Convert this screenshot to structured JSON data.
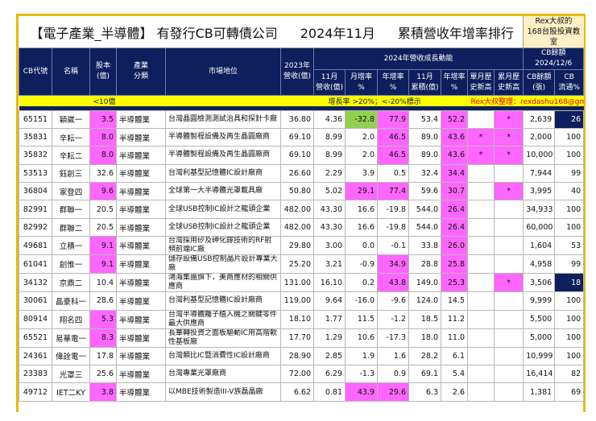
{
  "title": {
    "part1": "【電子產業_半導體】 有發行CB可轉債公司",
    "part2": "2024年11月",
    "part3": "累積營收年增率排行",
    "brand": "Rex大叔的\n168台股投資教室"
  },
  "headers": {
    "code": "CB代號",
    "name": "名稱",
    "capital": "股本\n(億)",
    "industry": "產業\n分類",
    "position": "市場地位",
    "rev2023": "2023年\n營收(億)",
    "growth_group": "2024年營收成長動能",
    "nov_rev": "11月\n營收(億)",
    "mom": "月增率\n%",
    "yoy": "年增率\n%",
    "cum": "11月\n累積(億)",
    "cum_yoy": "年增率\n%",
    "single_high": "單月歷\n史新高",
    "cum_high": "累月歷\n史新高",
    "cb_group": "CB餘額\n2024/12/6",
    "cb_balance": "CB餘額\n(張)",
    "cb_float": "CB\n流通%"
  },
  "legend": {
    "capital_note": "<10億",
    "growth_note": "增長率 >20%；<-20%標示",
    "credit": "Rex大叔整理：rexdashu168@gmail.com"
  },
  "colors": {
    "navy": "#0d1f5c",
    "highlight": "#ff66ff",
    "negative": "#92d050",
    "note": "#ffff00",
    "frame": "#e8b80c"
  },
  "rows": [
    {
      "code": "65151",
      "name": "穎崴一",
      "capital": "3.5",
      "industry": "半導體業",
      "position": "台灣晶圓檢測測試治具和探針卡廠",
      "rev2023": "36.80",
      "nov_rev": "4.36",
      "mom": "-32.8",
      "yoy": "77.9",
      "cum": "53.4",
      "cum_yoy": "52.2",
      "single_high": "",
      "cum_high": "*",
      "cb_balance": "2,639",
      "cb_float": "26",
      "float_hl": true
    },
    {
      "code": "35831",
      "name": "辛耘一",
      "capital": "8.0",
      "industry": "半導體業",
      "position": "半導體製程設備及再生晶圓廠商",
      "rev2023": "69.10",
      "nov_rev": "8.99",
      "mom": "2.0",
      "yoy": "46.5",
      "cum": "89.0",
      "cum_yoy": "43.6",
      "single_high": "*",
      "cum_high": "*",
      "cb_balance": "2,000",
      "cb_float": "100",
      "float_hl": false
    },
    {
      "code": "35832",
      "name": "辛耘二",
      "capital": "8.0",
      "industry": "半導體業",
      "position": "半導體製程設備及再生晶圓廠商",
      "rev2023": "69.10",
      "nov_rev": "8.99",
      "mom": "2.0",
      "yoy": "46.5",
      "cum": "89.0",
      "cum_yoy": "43.6",
      "single_high": "*",
      "cum_high": "*",
      "cb_balance": "10,000",
      "cb_float": "100",
      "float_hl": false
    },
    {
      "code": "53513",
      "name": "鈺創三",
      "capital": "32.6",
      "industry": "半導體業",
      "position": "台灣利基型記憶體IC設計廠商",
      "rev2023": "26.60",
      "nov_rev": "2.29",
      "mom": "3.9",
      "yoy": "0.5",
      "cum": "32.4",
      "cum_yoy": "34.4",
      "single_high": "",
      "cum_high": "",
      "cb_balance": "7,944",
      "cb_float": "99",
      "float_hl": false
    },
    {
      "code": "36804",
      "name": "家登四",
      "capital": "9.6",
      "industry": "半導體業",
      "position": "全球第一大半導體光罩載具廠",
      "rev2023": "50.80",
      "nov_rev": "5.02",
      "mom": "29.1",
      "yoy": "77.4",
      "cum": "59.6",
      "cum_yoy": "30.7",
      "single_high": "",
      "cum_high": "*",
      "cb_balance": "3,995",
      "cb_float": "40",
      "float_hl": false
    },
    {
      "code": "82991",
      "name": "群聯一",
      "capital": "20.5",
      "industry": "半導體業",
      "position": "全球USB控制IC設計之龍頭企業",
      "rev2023": "482.00",
      "nov_rev": "43.30",
      "mom": "16.6",
      "yoy": "-19.8",
      "cum": "544.0",
      "cum_yoy": "26.4",
      "single_high": "",
      "cum_high": "",
      "cb_balance": "34,933",
      "cb_float": "100",
      "float_hl": false
    },
    {
      "code": "82992",
      "name": "群聯二",
      "capital": "20.5",
      "industry": "半導體業",
      "position": "全球USB控制IC設計之龍頭企業",
      "rev2023": "482.00",
      "nov_rev": "43.30",
      "mom": "16.6",
      "yoy": "-19.8",
      "cum": "544.0",
      "cum_yoy": "26.4",
      "single_high": "",
      "cum_high": "",
      "cb_balance": "60,000",
      "cb_float": "100",
      "float_hl": false
    },
    {
      "code": "49681",
      "name": "立積一",
      "capital": "9.1",
      "industry": "半導體業",
      "position": "台灣採用矽及砷化鎵技術的RF射頻前端IC廠",
      "rev2023": "29.80",
      "nov_rev": "3.00",
      "mom": "0.0",
      "yoy": "-0.1",
      "cum": "33.8",
      "cum_yoy": "26.0",
      "single_high": "",
      "cum_high": "",
      "cb_balance": "1,604",
      "cb_float": "53",
      "float_hl": false
    },
    {
      "code": "61041",
      "name": "創惟一",
      "capital": "9.1",
      "industry": "半導體業",
      "position": "儲存設備USB控制晶片設計專業大廠",
      "rev2023": "25.20",
      "nov_rev": "3.21",
      "mom": "-0.9",
      "yoy": "34.9",
      "cum": "28.8",
      "cum_yoy": "25.8",
      "single_high": "",
      "cum_high": "",
      "cb_balance": "4,958",
      "cb_float": "99",
      "float_hl": false
    },
    {
      "code": "34132",
      "name": "京鼎二",
      "capital": "10.4",
      "industry": "半導體業",
      "position": "鴻海集團旗下，美商應材的相關供應商",
      "rev2023": "131.00",
      "nov_rev": "16.10",
      "mom": "0.2",
      "yoy": "43.8",
      "cum": "149.0",
      "cum_yoy": "25.3",
      "single_high": "",
      "cum_high": "*",
      "cb_balance": "3,506",
      "cb_float": "18",
      "float_hl": true
    },
    {
      "code": "30061",
      "name": "晶豪科一",
      "capital": "28.6",
      "industry": "半導體業",
      "position": "台灣利基型記憶體IC設計廠商",
      "rev2023": "119.00",
      "nov_rev": "9.64",
      "mom": "-16.0",
      "yoy": "-9.6",
      "cum": "124.0",
      "cum_yoy": "14.5",
      "single_high": "",
      "cum_high": "",
      "cb_balance": "9,999",
      "cb_float": "100",
      "float_hl": false
    },
    {
      "code": "80914",
      "name": "翔名四",
      "capital": "5.3",
      "industry": "半導體業",
      "position": "台灣半導體離子植入機之關鍵零件最大供應商",
      "rev2023": "18.10",
      "nov_rev": "1.77",
      "mom": "11.5",
      "yoy": "-1.2",
      "cum": "18.5",
      "cum_yoy": "11.2",
      "single_high": "",
      "cum_high": "",
      "cb_balance": "5,500",
      "cb_float": "100",
      "float_hl": false
    },
    {
      "code": "65521",
      "name": "易華電一",
      "capital": "8.3",
      "industry": "半導體業",
      "position": "長華轉投資之面板驅動IC用高階軟性基板廠",
      "rev2023": "17.70",
      "nov_rev": "1.29",
      "mom": "10.6",
      "yoy": "-17.3",
      "cum": "18.0",
      "cum_yoy": "11.0",
      "single_high": "",
      "cum_high": "",
      "cb_balance": "5,000",
      "cb_float": "100",
      "float_hl": false
    },
    {
      "code": "24361",
      "name": "偉詮電一",
      "capital": "17.8",
      "industry": "半導體業",
      "position": "台灣類比IC暨消費性IC設計廠商",
      "rev2023": "28.90",
      "nov_rev": "2.85",
      "mom": "1.9",
      "yoy": "1.6",
      "cum": "28.2",
      "cum_yoy": "6.1",
      "single_high": "",
      "cum_high": "",
      "cb_balance": "10,999",
      "cb_float": "100",
      "float_hl": false
    },
    {
      "code": "23383",
      "name": "光罩三",
      "capital": "25.6",
      "industry": "半導體業",
      "position": "台灣專業光罩廠商",
      "rev2023": "72.00",
      "nov_rev": "6.29",
      "mom": "-1.3",
      "yoy": "0.9",
      "cum": "69.1",
      "cum_yoy": "5.4",
      "single_high": "",
      "cum_high": "",
      "cb_balance": "16,414",
      "cb_float": "82",
      "float_hl": false
    },
    {
      "code": "49712",
      "name": "IET二KY",
      "capital": "3.8",
      "industry": "半導體業",
      "position": "以MBE技術製造III-V族磊晶廠",
      "rev2023": "6.62",
      "nov_rev": "0.81",
      "mom": "43.9",
      "yoy": "29.6",
      "cum": "6.3",
      "cum_yoy": "2.6",
      "single_high": "",
      "cum_high": "",
      "cb_balance": "1,381",
      "cb_float": "69",
      "float_hl": false
    }
  ]
}
